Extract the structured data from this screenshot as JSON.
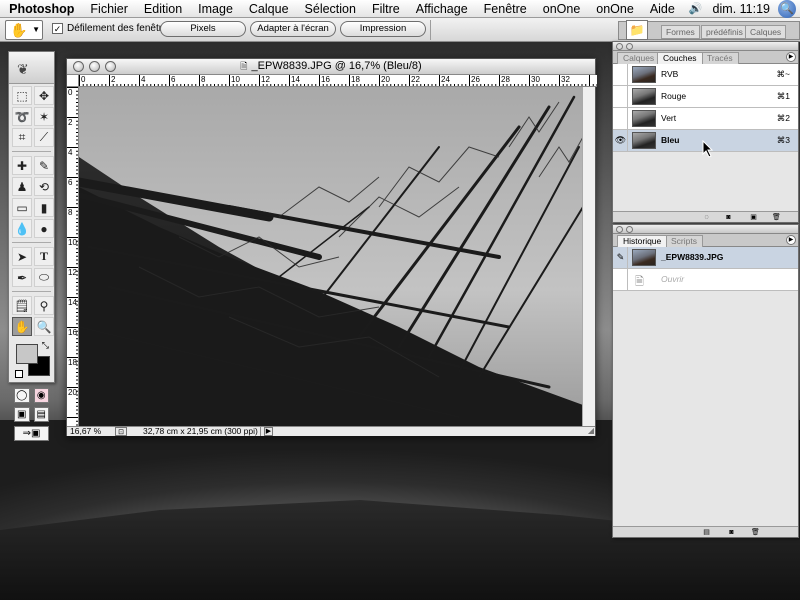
{
  "menubar": {
    "app_name": "Photoshop",
    "items": [
      "Fichier",
      "Edition",
      "Image",
      "Calque",
      "Sélection",
      "Filtre",
      "Affichage",
      "Fenêtre",
      "onOne",
      "onOne",
      "Aide"
    ],
    "clock": "dim. 11:19",
    "apple_icon": "",
    "volume_icon": "🔊",
    "spotlight_icon": "🔍"
  },
  "options_bar": {
    "scroll_all_windows_label": "Défilement des fenêtres",
    "scroll_all_windows_checked": true,
    "check_mark": "✓",
    "buttons": {
      "pixels": "Pixels",
      "fit_screen": "Adapter à l'écran",
      "print": "Impression"
    },
    "well_tabs": [
      "Formes",
      "prédéfinis",
      "Calques"
    ]
  },
  "document": {
    "title": "_EPW8839.JPG @ 16,7% (Bleu/8)",
    "zoom": "16,67 %",
    "info": "32,78 cm x 21,95 cm (300 ppi)",
    "ruler_h": [
      "0",
      "2",
      "4",
      "6",
      "8",
      "10",
      "12",
      "14",
      "16",
      "18",
      "20",
      "22",
      "24",
      "26",
      "28",
      "30",
      "32"
    ],
    "ruler_v": [
      "0",
      "2",
      "4",
      "6",
      "8",
      "10",
      "12",
      "14",
      "16",
      "18",
      "20"
    ]
  },
  "channels_palette": {
    "tabs": [
      "Calques",
      "Couches",
      "Tracés"
    ],
    "active_tab": "Couches",
    "channels": [
      {
        "name": "RVB",
        "key": "⌘~",
        "visible": false,
        "selected": false
      },
      {
        "name": "Rouge",
        "key": "⌘1",
        "visible": false,
        "selected": false
      },
      {
        "name": "Vert",
        "key": "⌘2",
        "visible": false,
        "selected": false
      },
      {
        "name": "Bleu",
        "key": "⌘3",
        "visible": true,
        "selected": true
      }
    ]
  },
  "history_palette": {
    "tabs": [
      "Historique",
      "Scripts"
    ],
    "active_tab": "Historique",
    "snapshot": "_EPW8839.JPG",
    "states": [
      {
        "name": "Ouvrir",
        "faded": true
      }
    ]
  }
}
